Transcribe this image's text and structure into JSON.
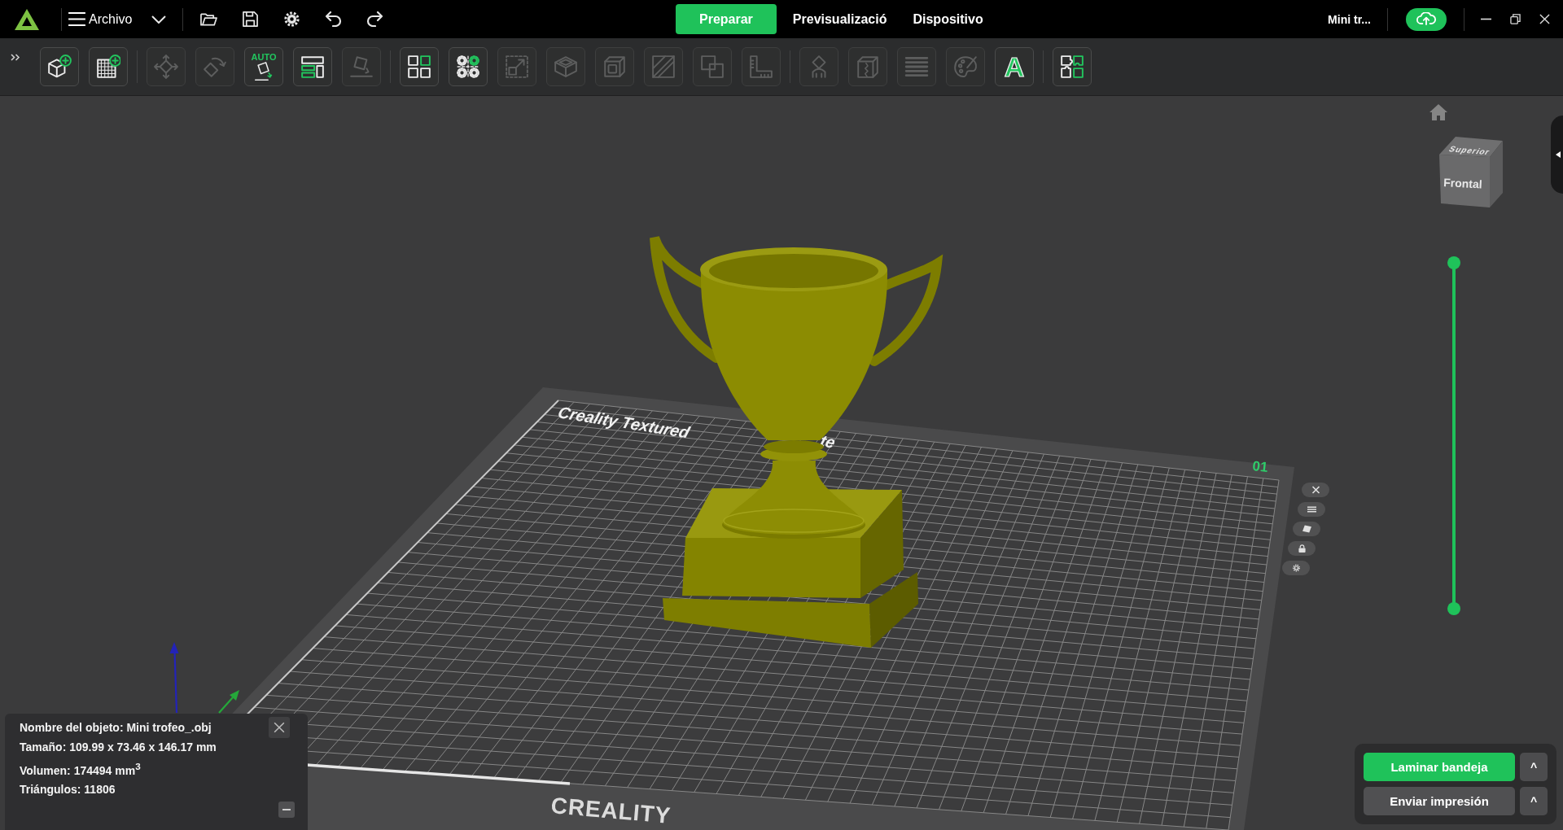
{
  "topbar": {
    "menu_label": "Archivo",
    "tabs": [
      {
        "label": "Preparar",
        "selected": true
      },
      {
        "label": "Previsualizació",
        "selected": false
      },
      {
        "label": "Dispositivo",
        "selected": false
      }
    ],
    "project_name": "Mini tr..."
  },
  "toolbar": {
    "groups": [
      {
        "tools": [
          {
            "kind": "addobject",
            "disabled": false
          },
          {
            "kind": "addplate",
            "disabled": false
          }
        ]
      },
      {
        "tools": [
          {
            "kind": "move",
            "disabled": true
          },
          {
            "kind": "rotate",
            "disabled": true
          },
          {
            "kind": "autoorient",
            "label": "AUTO",
            "disabled": false
          },
          {
            "kind": "arrange",
            "disabled": false
          },
          {
            "kind": "layface",
            "disabled": true
          }
        ]
      },
      {
        "tools": [
          {
            "kind": "splitobjects",
            "disabled": false
          },
          {
            "kind": "splitparts",
            "disabled": false
          },
          {
            "kind": "scale",
            "disabled": true
          },
          {
            "kind": "hollow",
            "disabled": true
          },
          {
            "kind": "cube",
            "disabled": true
          },
          {
            "kind": "cut",
            "disabled": true
          },
          {
            "kind": "boolean",
            "disabled": true
          },
          {
            "kind": "measure",
            "disabled": true
          }
        ]
      },
      {
        "tools": [
          {
            "kind": "support",
            "disabled": true
          },
          {
            "kind": "seam",
            "disabled": true
          },
          {
            "kind": "layers",
            "disabled": true
          },
          {
            "kind": "paint",
            "disabled": true
          },
          {
            "kind": "text",
            "label": "A",
            "disabled": false
          }
        ]
      },
      {
        "tools": [
          {
            "kind": "puzzle",
            "disabled": false
          }
        ]
      }
    ]
  },
  "viewport": {
    "plate": {
      "title_parts": [
        "Creality Textured",
        "te"
      ],
      "number": "01",
      "brand": "CREALITY"
    },
    "view_cube": {
      "top": "Superior",
      "front": "Frontal"
    },
    "layer_slider": {
      "level": 1
    }
  },
  "object_info": {
    "lines": [
      "Nombre del objeto: Mini trofeo_.obj",
      "Tamaño: 109.99 x 73.46 x 146.17 mm",
      "Volumen: 174494 mm$^{3}$",
      "Triángulos: 11806"
    ]
  },
  "slice_panel": {
    "buttons": [
      {
        "label": "Laminar bandeja",
        "kind": "primary",
        "caret": "^"
      },
      {
        "label": "Enviar impresión",
        "kind": "secondary",
        "caret": "^"
      }
    ]
  }
}
